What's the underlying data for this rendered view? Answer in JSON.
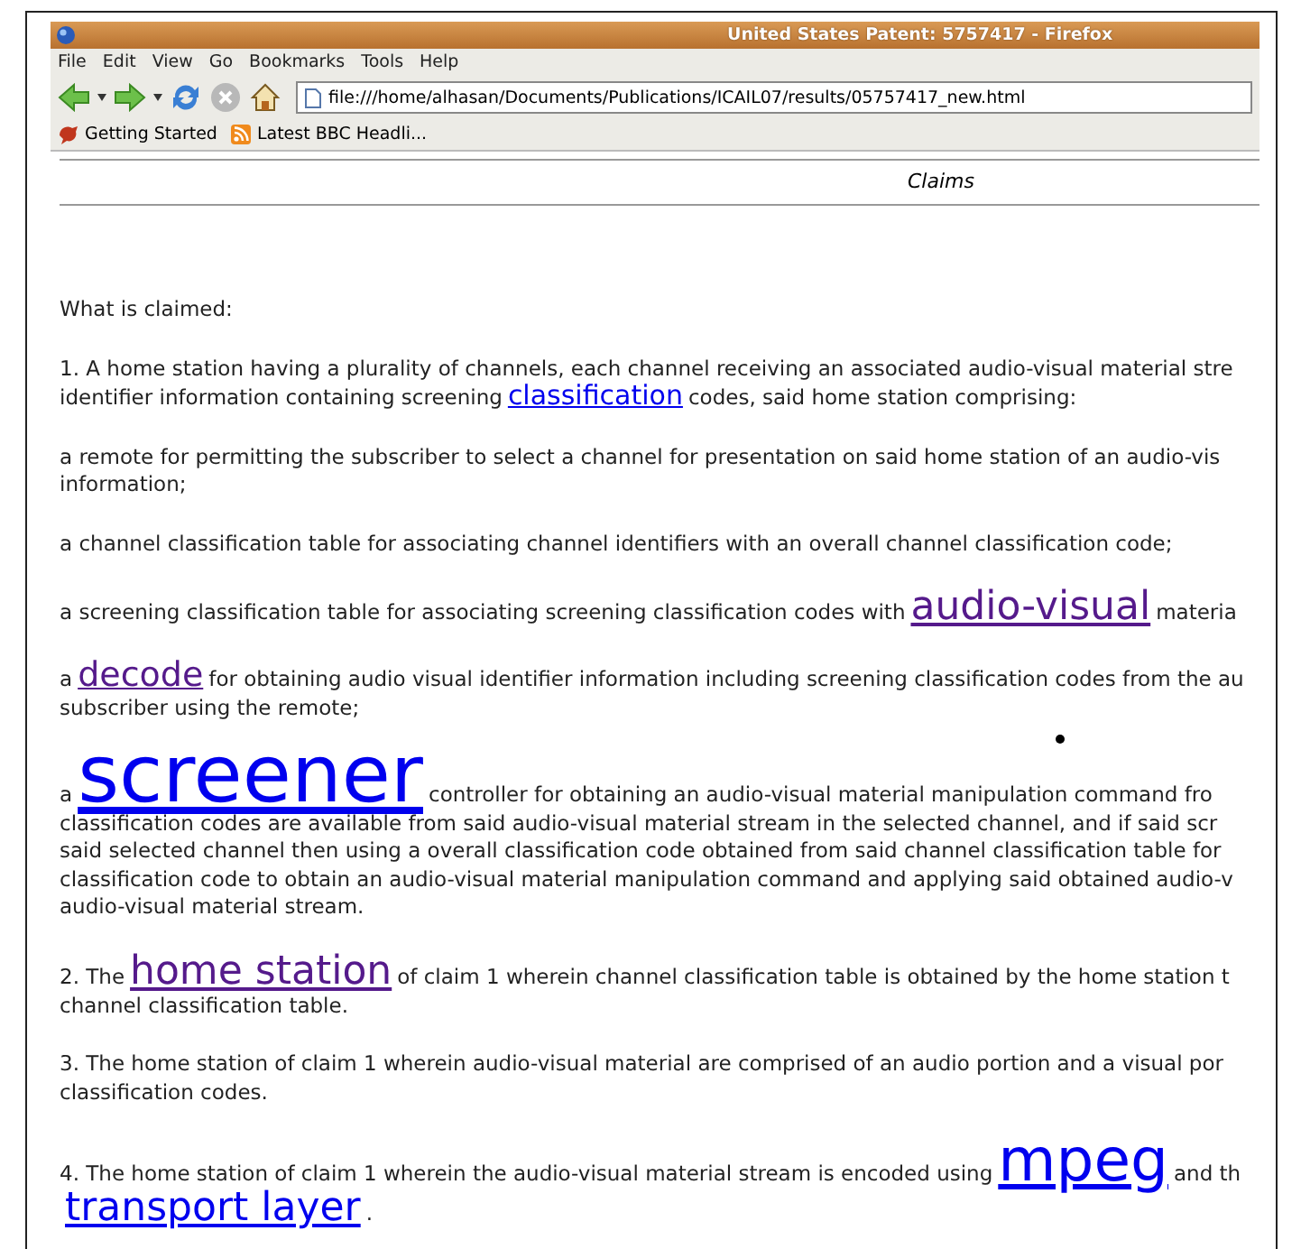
{
  "window": {
    "title": "United States Patent: 5757417 - Firefox"
  },
  "menu": [
    "File",
    "Edit",
    "View",
    "Go",
    "Bookmarks",
    "Tools",
    "Help"
  ],
  "toolbar": {
    "stop_disabled": true,
    "url": "file:///home/alhasan/Documents/Publications/ICAIL07/results/05757417_new.html"
  },
  "bookmarks": [
    {
      "kind": "page",
      "label": "Getting Started"
    },
    {
      "kind": "feed",
      "label": "Latest BBC Headli..."
    }
  ],
  "heading": "Claims",
  "paragraphs": [
    {
      "lines": [
        [
          {
            "text": "What is claimed:"
          }
        ]
      ]
    },
    {
      "lines": [
        [
          {
            "text": "1. A home station having a plurality of channels, each channel receiving an associated audio-visual material stre"
          }
        ],
        [
          {
            "text": "identifier information containing screening"
          },
          {
            "link": "classification",
            "visited": false,
            "kind": "small"
          },
          {
            "text": "codes, said home station comprising:"
          }
        ]
      ]
    },
    {
      "lines": [
        [
          {
            "text": "a remote for permitting the subscriber to select a channel for presentation on said home station of an audio-vis"
          }
        ],
        [
          {
            "text": "information;"
          }
        ]
      ]
    },
    {
      "lines": [
        [
          {
            "text": "a channel classification table for associating channel identifiers with an overall channel classification code;"
          }
        ]
      ]
    },
    {
      "lines": [
        [
          {
            "text": "a screening classification table for associating screening classification codes with"
          },
          {
            "link": "audio-visual",
            "visited": true,
            "kind": "large"
          },
          {
            "text": "materia"
          }
        ]
      ]
    },
    {
      "lines": [
        [
          {
            "text": "a"
          },
          {
            "link": "decode",
            "visited": true,
            "kind": "medium"
          },
          {
            "text": "for obtaining audio visual identifier information including screening classification codes from the au"
          }
        ],
        [
          {
            "text": "subscriber using the remote;"
          }
        ]
      ]
    },
    {
      "lines": [
        [
          {
            "text": "a"
          },
          {
            "link": "screener",
            "visited": false,
            "kind": "huge"
          },
          {
            "text": "controller for obtaining an audio-visual material manipulation command fro"
          }
        ],
        [
          {
            "text": "classification codes are available from said audio-visual material stream in the selected channel, and if said scr"
          }
        ],
        [
          {
            "text": "said selected channel then using a overall classification code obtained from said channel classification table for"
          }
        ],
        [
          {
            "text": "classification code to obtain an audio-visual material manipulation command and applying said obtained audio-v"
          }
        ],
        [
          {
            "text": "audio-visual material stream."
          }
        ]
      ]
    },
    {
      "lines": [
        [
          {
            "text": "2. The"
          },
          {
            "link": "home station",
            "visited": true,
            "kind": "large"
          },
          {
            "text": "of claim 1 wherein channel classification table is obtained by the home station t"
          }
        ],
        [
          {
            "text": "channel classification table."
          }
        ]
      ]
    },
    {
      "lines": [
        [
          {
            "text": "3. The home station of claim 1 wherein audio-visual material are comprised of an audio portion and a visual por"
          }
        ],
        [
          {
            "text": "classification codes."
          }
        ]
      ]
    },
    {
      "lines": [
        [
          {
            "text": "4. The home station of claim 1 wherein the audio-visual material stream is encoded using"
          },
          {
            "link": "mpeg",
            "visited": false,
            "kind": "xlarge"
          },
          {
            "text": "and th"
          }
        ],
        [
          {
            "link": "transport layer",
            "visited": false,
            "kind": "large"
          },
          {
            "text": "."
          }
        ]
      ]
    }
  ]
}
